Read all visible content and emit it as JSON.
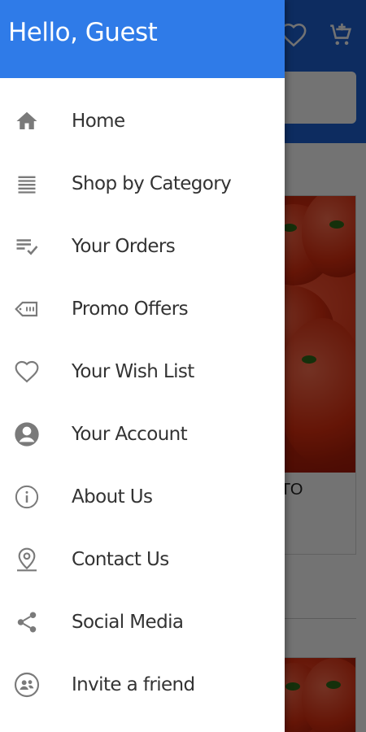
{
  "drawer": {
    "greeting": "Hello, Guest",
    "items": [
      {
        "label": "Home",
        "icon": "home-icon"
      },
      {
        "label": "Shop by Category",
        "icon": "list-icon"
      },
      {
        "label": "Your Orders",
        "icon": "orders-check-icon"
      },
      {
        "label": "Promo Offers",
        "icon": "tag-icon"
      },
      {
        "label": "Your Wish List",
        "icon": "heart-icon"
      },
      {
        "label": "Your Account",
        "icon": "account-icon"
      },
      {
        "label": "About Us",
        "icon": "info-icon"
      },
      {
        "label": "Contact Us",
        "icon": "location-pin-icon"
      },
      {
        "label": "Social Media",
        "icon": "share-icon"
      },
      {
        "label": "Invite a friend",
        "icon": "invite-people-icon"
      }
    ]
  },
  "background": {
    "app_bar_color": "#1d63d6",
    "product_name_partial": "TO"
  },
  "colors": {
    "drawer_header": "#2f7be8",
    "icon": "#7a7a7a",
    "text": "#333333"
  }
}
